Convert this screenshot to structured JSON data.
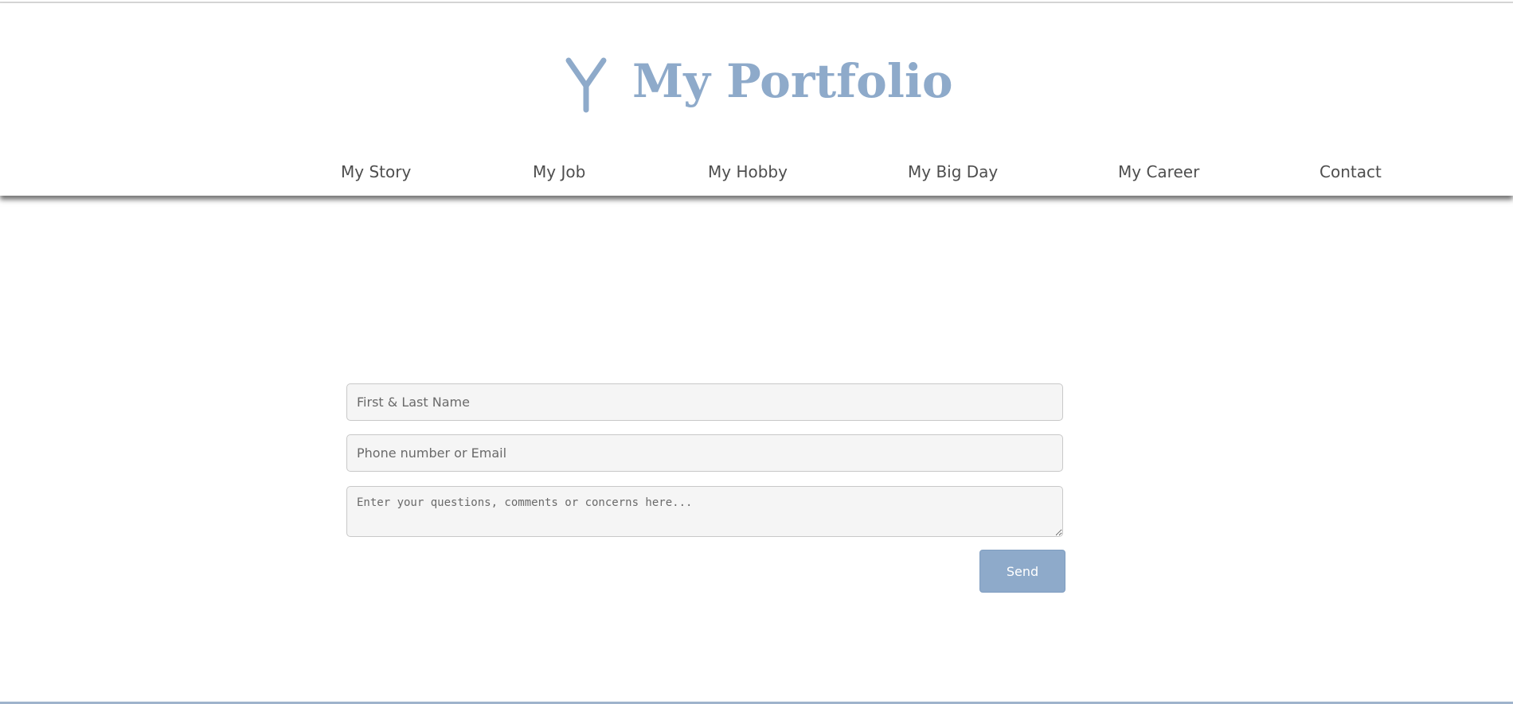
{
  "header": {
    "title": "My Portfolio",
    "logo_icon": "y-branch-logo-icon",
    "brand_color": "#8eaaca"
  },
  "nav": {
    "items": [
      {
        "label": "My Story"
      },
      {
        "label": "My Job"
      },
      {
        "label": "My Hobby"
      },
      {
        "label": "My Big Day"
      },
      {
        "label": "My Career"
      },
      {
        "label": "Contact"
      }
    ]
  },
  "form": {
    "name_placeholder": "First & Last Name",
    "contact_placeholder": "Phone number or Email",
    "message_placeholder": "Enter your questions, comments or concerns here...",
    "send_label": "Send",
    "button_color": "#8eaaca"
  }
}
